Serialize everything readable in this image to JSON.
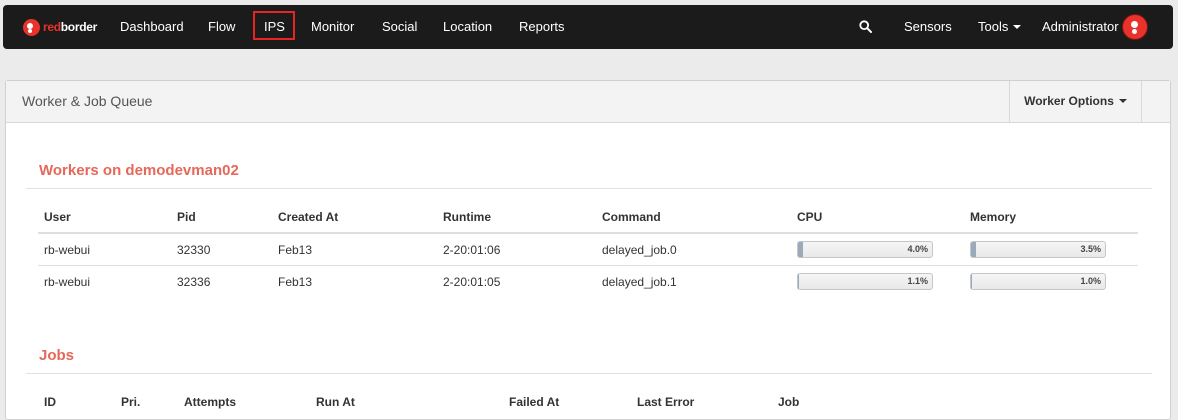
{
  "brand": {
    "part1": "red",
    "part2": "border"
  },
  "nav": {
    "items": [
      "Dashboard",
      "Flow",
      "IPS",
      "Monitor",
      "Social",
      "Location",
      "Reports"
    ],
    "right": {
      "sensors": "Sensors",
      "tools": "Tools",
      "user": "Administrator"
    }
  },
  "panel": {
    "title": "Worker & Job Queue",
    "options_label": "Worker Options"
  },
  "workers": {
    "title": "Workers on demodevman02",
    "columns": [
      "User",
      "Pid",
      "Created At",
      "Runtime",
      "Command",
      "CPU",
      "Memory"
    ],
    "rows": [
      {
        "user": "rb-webui",
        "pid": "32330",
        "created": "Feb13",
        "runtime": "2-20:01:06",
        "command": "delayed_job.0",
        "cpu_label": "4.0%",
        "cpu": 4.0,
        "mem_label": "3.5%",
        "mem": 3.5
      },
      {
        "user": "rb-webui",
        "pid": "32336",
        "created": "Feb13",
        "runtime": "2-20:01:05",
        "command": "delayed_job.1",
        "cpu_label": "1.1%",
        "cpu": 1.1,
        "mem_label": "1.0%",
        "mem": 1.0
      }
    ]
  },
  "jobs": {
    "title": "Jobs",
    "columns": [
      "ID",
      "Pri.",
      "Attempts",
      "Run At",
      "Failed At",
      "Last Error",
      "Job"
    ]
  },
  "colors": {
    "accent": "#e8322b",
    "section_title": "#e5685a",
    "navbar": "#1b1b1b"
  }
}
